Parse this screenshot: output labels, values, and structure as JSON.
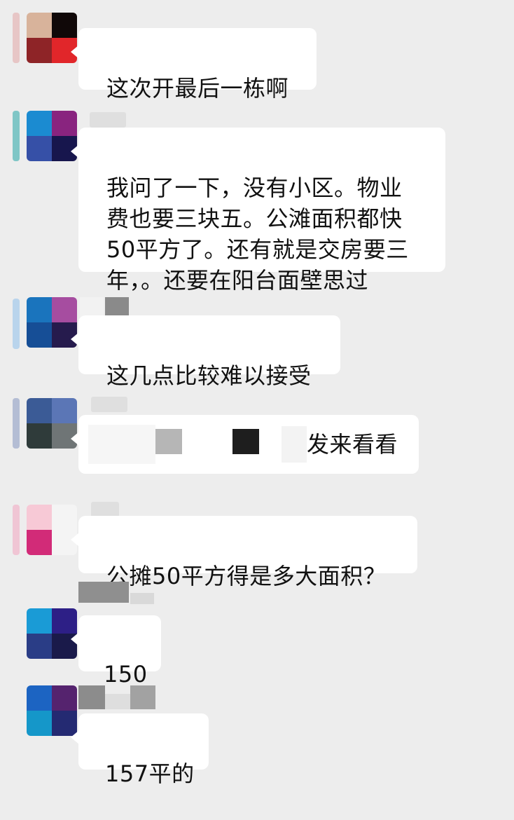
{
  "messages": [
    {
      "text": "这次开最后一栋啊"
    },
    {
      "text": "我问了一下，没有小区。物业\n费也要三块五。公滩面积都快\n50平方了。还有就是交房要三\n年，。还要在阳台面壁思过"
    },
    {
      "text": "这几点比较难以接受"
    },
    {
      "text": "发来看看"
    },
    {
      "text": "公摊50平方得是多大面积？"
    },
    {
      "text": "150"
    },
    {
      "text": "157平的"
    }
  ],
  "colors": {
    "background": "#ededed",
    "bubble": "#ffffff",
    "text": "#111111"
  }
}
